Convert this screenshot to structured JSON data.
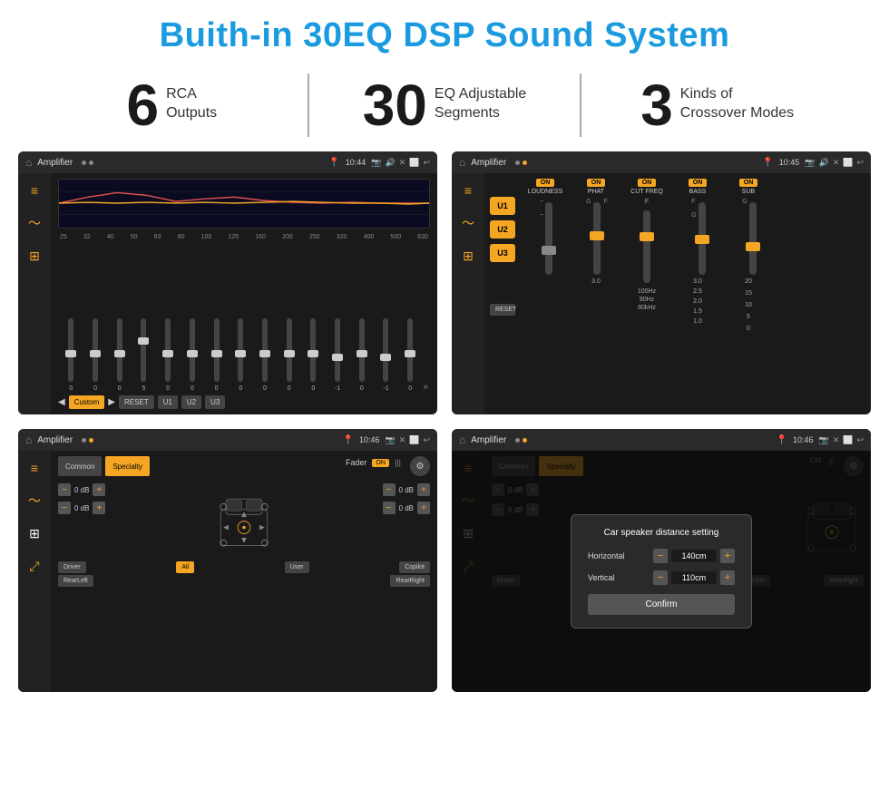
{
  "title": "Buith-in 30EQ DSP Sound System",
  "stats": [
    {
      "number": "6",
      "label": "RCA\nOutputs"
    },
    {
      "number": "30",
      "label": "EQ Adjustable\nSegments"
    },
    {
      "number": "3",
      "label": "Kinds of\nCrossover Modes"
    }
  ],
  "screens": {
    "screen1": {
      "header": {
        "title": "Amplifier",
        "time": "10:44"
      },
      "eq_frequencies": [
        "25",
        "32",
        "40",
        "50",
        "63",
        "80",
        "100",
        "125",
        "160",
        "200",
        "250",
        "320",
        "400",
        "500",
        "630"
      ],
      "eq_values": [
        "0",
        "0",
        "0",
        "5",
        "0",
        "0",
        "0",
        "0",
        "0",
        "0",
        "0",
        "-1",
        "0",
        "-1"
      ],
      "buttons": [
        "Custom",
        "RESET",
        "U1",
        "U2",
        "U3"
      ]
    },
    "screen2": {
      "header": {
        "title": "Amplifier",
        "time": "10:45"
      },
      "u_buttons": [
        "U1",
        "U2",
        "U3"
      ],
      "controls": [
        {
          "label": "LOUDNESS",
          "on": true
        },
        {
          "label": "PHAT",
          "on": true
        },
        {
          "label": "CUT FREQ",
          "on": true
        },
        {
          "label": "BASS",
          "on": true
        },
        {
          "label": "SUB",
          "on": true
        }
      ],
      "reset_label": "RESET"
    },
    "screen3": {
      "header": {
        "title": "Amplifier",
        "time": "10:46"
      },
      "tabs": [
        "Common",
        "Specialty"
      ],
      "active_tab": "Specialty",
      "fader_label": "Fader",
      "fader_on": "ON",
      "driver_label": "Driver",
      "copilot_label": "Copilot",
      "rear_left_label": "RearLeft",
      "all_label": "All",
      "user_label": "User",
      "rear_right_label": "RearRight",
      "db_values": [
        "0 dB",
        "0 dB",
        "0 dB",
        "0 dB"
      ]
    },
    "screen4": {
      "header": {
        "title": "Amplifier",
        "time": "10:46"
      },
      "tabs": [
        "Common",
        "Specialty"
      ],
      "dialog": {
        "title": "Car speaker distance setting",
        "horizontal_label": "Horizontal",
        "horizontal_value": "140cm",
        "vertical_label": "Vertical",
        "vertical_value": "110cm",
        "confirm_label": "Confirm"
      },
      "driver_label": "Driver",
      "copilot_label": "Copilot",
      "rear_left_label": "RearLeft",
      "user_label": "User",
      "rear_right_label": "RearRight",
      "db_values": [
        "0 dB",
        "0 dB"
      ]
    }
  }
}
